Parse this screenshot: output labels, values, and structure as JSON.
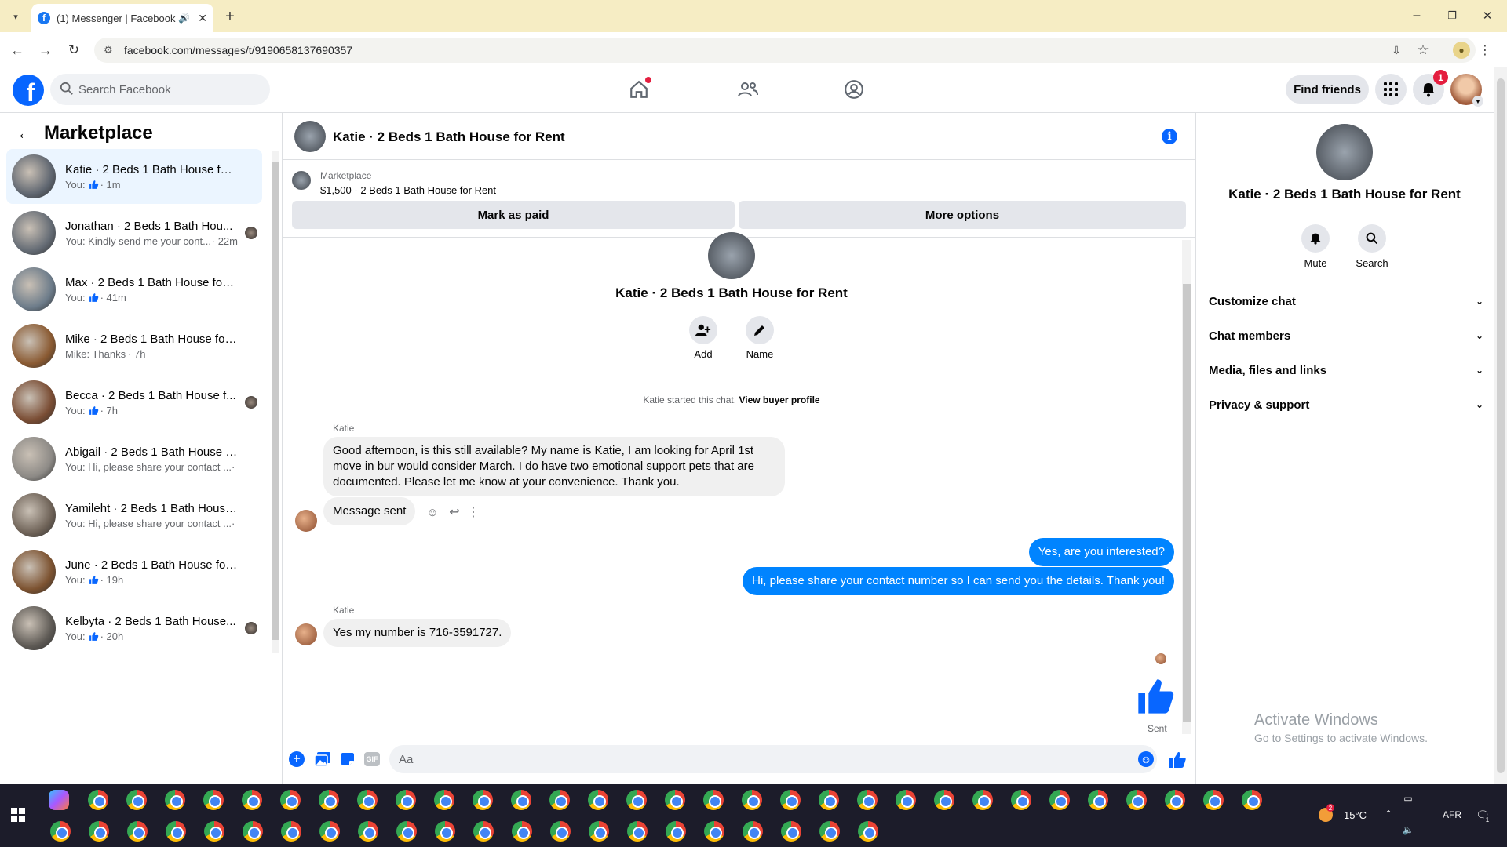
{
  "browser": {
    "tab_title": "(1) Messenger | Facebook",
    "url": "facebook.com/messages/t/9190658137690357"
  },
  "fb": {
    "logo_letter": "f",
    "search_placeholder": "Search Facebook",
    "find_friends": "Find friends",
    "notif_count": "1"
  },
  "left": {
    "title": "Marketplace",
    "conversations": [
      {
        "name": "Katie · 2 Beds 1 Bath House for ...",
        "preview": "You:",
        "like": true,
        "time": "· 1m",
        "active": true,
        "color": "#5f6670"
      },
      {
        "name": "Jonathan · 2 Beds 1 Bath Hou...",
        "preview": "You: Kindly send me your cont...",
        "like": false,
        "time": "· 22m",
        "active": false,
        "color": "#646b74"
      },
      {
        "name": "Max · 2 Beds 1 Bath House for R...",
        "preview": "You:",
        "like": true,
        "time": "· 41m",
        "active": false,
        "color": "#6d7c8a"
      },
      {
        "name": "Mike · 2 Beds 1 Bath House for ...",
        "preview": "Mike: Thanks",
        "like": false,
        "time": "· 7h",
        "active": false,
        "color": "#8a5a32"
      },
      {
        "name": "Becca · 2 Beds 1 Bath House f...",
        "preview": "You:",
        "like": true,
        "time": "· 7h",
        "active": false,
        "color": "#7a4d34"
      },
      {
        "name": "Abigail · 2 Beds 1 Bath House fo...",
        "preview": "You: Hi, please share your contact ...",
        "like": false,
        "time": "· 7h",
        "active": false,
        "color": "#8d8a86"
      },
      {
        "name": "Yamileht · 2 Beds 1 Bath House f...",
        "preview": "You: Hi, please share your contact ...",
        "like": false,
        "time": "· 7h",
        "active": false,
        "color": "#6e6257"
      },
      {
        "name": "June · 2 Beds 1 Bath House for R...",
        "preview": "You:",
        "like": true,
        "time": "· 19h",
        "active": false,
        "color": "#7c5230"
      },
      {
        "name": "Kelbyta · 2 Beds 1 Bath House...",
        "preview": "You:",
        "like": true,
        "time": "· 20h",
        "active": false,
        "color": "#5e5a55"
      }
    ]
  },
  "chat": {
    "header_title": "Katie · 2 Beds 1 Bath House for Rent",
    "listing_label": "Marketplace",
    "listing_text": "$1,500 - 2 Beds 1 Bath House for Rent",
    "mark_paid": "Mark as paid",
    "more_options": "More options",
    "profile_name": "Katie · 2 Beds 1 Bath House for Rent",
    "add_label": "Add",
    "name_label": "Name",
    "started_text": "Katie started this chat.",
    "buyer_profile": "View buyer profile",
    "sender1": "Katie",
    "msg1": "Good afternoon, is this still available? My name is Katie, I am looking for April 1st move in bur would consider March. I do have two emotional support pets that are documented. Please let me know at your convenience. Thank you.",
    "msg2": "Message sent",
    "msg3": "Yes, are you interested?",
    "msg4": "Hi, please share your contact number so I can send you the details. Thank you!",
    "sender2": "Katie",
    "msg5": "Yes my number is 716-3591727.",
    "sent_label": "Sent",
    "composer_placeholder": "Aa"
  },
  "right": {
    "name": "Katie · 2 Beds 1 Bath House for Rent",
    "mute": "Mute",
    "search": "Search",
    "rows": [
      "Customize chat",
      "Chat members",
      "Media, files and links",
      "Privacy & support"
    ]
  },
  "watermark": {
    "line1": "Activate Windows",
    "line2": "Go to Settings to activate Windows."
  },
  "taskbar": {
    "temperature": "15°C",
    "lang": "AFR",
    "weather_badge": "2",
    "notif_badge": "1"
  },
  "colors": {
    "fb_blue": "#0866ff",
    "bubble_blue": "#0084ff",
    "active_bg": "#ebf5ff"
  }
}
